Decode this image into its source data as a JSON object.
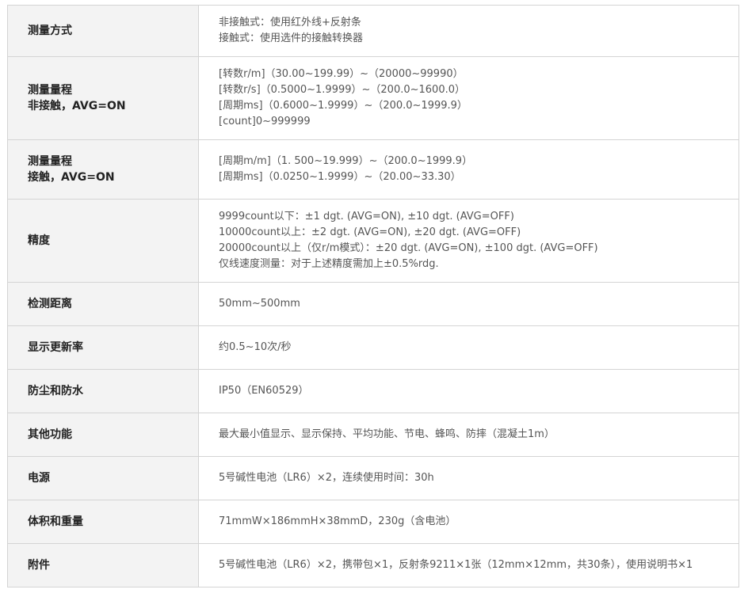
{
  "spec_table": {
    "rows": [
      {
        "label": "测量方式",
        "values": [
          "非接触式：使用红外线+反射条",
          "接触式：使用选件的接触转换器"
        ]
      },
      {
        "label": "测量量程\n非接触，AVG=ON",
        "values": [
          "[转数r/m]（30.00~199.99）~（20000~99990）",
          "[转数r/s]（0.5000~1.9999）~（200.0~1600.0）",
          "[周期ms]（0.6000~1.9999）~（200.0~1999.9）",
          "[count]0~999999"
        ]
      },
      {
        "label": "测量量程\n接触，AVG=ON",
        "values": [
          "[周期m/m]（1. 500~19.999）~（200.0~1999.9）",
          "[周期ms]（0.0250~1.9999）~（20.00~33.30）"
        ]
      },
      {
        "label": "精度",
        "values": [
          "9999count以下：±1 dgt. (AVG=ON), ±10 dgt. (AVG=OFF)",
          "10000count以上：±2 dgt. (AVG=ON), ±20 dgt. (AVG=OFF)",
          "20000count以上（仅r/m模式）：±20 dgt. (AVG=ON), ±100 dgt. (AVG=OFF)",
          "仅线速度测量：对于上述精度需加上±0.5%rdg."
        ]
      },
      {
        "label": "检测距离",
        "values": [
          "50mm~500mm"
        ]
      },
      {
        "label": "显示更新率",
        "values": [
          "约0.5~10次/秒"
        ]
      },
      {
        "label": "防尘和防水",
        "values": [
          "IP50（EN60529）"
        ]
      },
      {
        "label": "其他功能",
        "values": [
          "最大最小值显示、显示保持、平均功能、节电、蜂鸣、防摔（混凝土1m）"
        ]
      },
      {
        "label": "电源",
        "values": [
          "5号碱性电池（LR6）×2，连续使用时间：30h"
        ]
      },
      {
        "label": "体积和重量",
        "values": [
          "71mmW×186mmH×38mmD，230g（含电池）"
        ]
      },
      {
        "label": "附件",
        "values": [
          "5号碱性电池（LR6）×2，携带包×1，反射条9211×1张（12mm×12mm，共30条），使用说明书×1"
        ]
      }
    ]
  }
}
